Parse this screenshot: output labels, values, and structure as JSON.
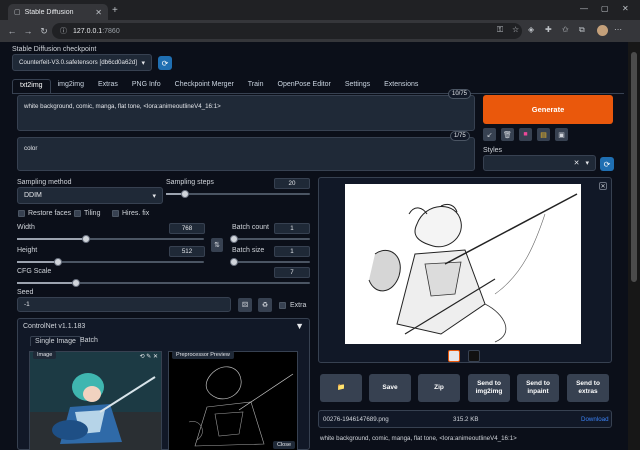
{
  "browser": {
    "tab_title": "Stable Diffusion",
    "url_host": "127.0.0.1",
    "url_port": ":7860"
  },
  "checkpoint": {
    "label": "Stable Diffusion checkpoint",
    "value": "Counterfeit-V3.0.safetensors [db6cd0a62d]"
  },
  "tabs": [
    "txt2img",
    "img2img",
    "Extras",
    "PNG Info",
    "Checkpoint Merger",
    "Train",
    "OpenPose Editor",
    "Settings",
    "Extensions"
  ],
  "prompt": {
    "positive": "white background, comic, manga, flat tone, <lora:animeoutlineV4_16:1>",
    "positive_count": "10/75",
    "negative": "color",
    "negative_count": "1/75"
  },
  "generate_label": "Generate",
  "styles_label": "Styles",
  "sampling": {
    "method_label": "Sampling method",
    "method_value": "DDIM",
    "steps_label": "Sampling steps",
    "steps_value": "20",
    "steps_fraction": 0.13
  },
  "checkboxes": {
    "restore_faces": "Restore faces",
    "tiling": "Tiling",
    "hires_fix": "Hires. fix"
  },
  "size": {
    "width_label": "Width",
    "width_value": "768",
    "width_fraction": 0.37,
    "height_label": "Height",
    "height_value": "512",
    "height_fraction": 0.22
  },
  "batch": {
    "count_label": "Batch count",
    "count_value": "1",
    "size_label": "Batch size",
    "size_value": "1"
  },
  "cfg": {
    "label": "CFG Scale",
    "value": "7",
    "fraction": 0.2
  },
  "seed": {
    "label": "Seed",
    "value": "-1",
    "extra_label": "Extra"
  },
  "controlnet": {
    "title": "ControlNet v1.1.183",
    "tab_single": "Single Image",
    "tab_batch": "Batch",
    "image_label": "Image",
    "preview_label": "Preprocessor Preview",
    "close_label": "Close"
  },
  "output": {
    "buttons": {
      "folder": "📁",
      "save": "Save",
      "zip": "Zip",
      "send_img2img": "Send to img2img",
      "send_inpaint": "Send to inpaint",
      "send_extras": "Send to extras"
    },
    "filename": "00276-1946147689.png",
    "filesize": "315.2 KB",
    "download": "Download",
    "caption": "white background, comic, manga, flat tone, <lora:animeoutlineV4_16:1>"
  }
}
